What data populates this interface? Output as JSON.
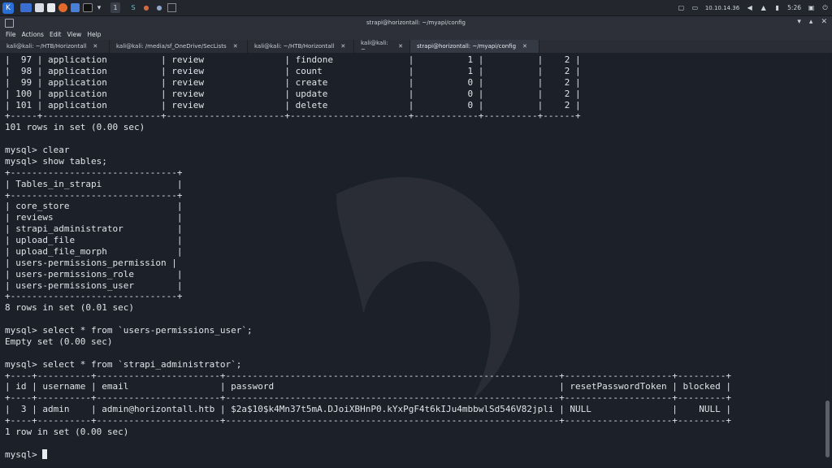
{
  "panel": {
    "workspace_label": "1",
    "ip_address": "10.10.14.36",
    "clock": "5:26"
  },
  "window": {
    "title": "strapi@horizontall: ~/myapi/config"
  },
  "menu": [
    "File",
    "Actions",
    "Edit",
    "View",
    "Help"
  ],
  "tabs": [
    {
      "label": "kali@kali: ~/HTB/Horizontall"
    },
    {
      "label": "kali@kali: /media/sf_OneDrive/SecLists"
    },
    {
      "label": "kali@kali: ~/HTB/Horizontall"
    },
    {
      "label": "kali@kali: ~"
    },
    {
      "label": "strapi@horizontall: ~/myapi/config"
    }
  ],
  "terminal": {
    "lines": [
      "|  97 | application          | review               | findone              |          1 |          |    2 |",
      "|  98 | application          | review               | count                |          1 |          |    2 |",
      "|  99 | application          | review               | create               |          0 |          |    2 |",
      "| 100 | application          | review               | update               |          0 |          |    2 |",
      "| 101 | application          | review               | delete               |          0 |          |    2 |",
      "+-----+----------------------+----------------------+----------------------+------------+----------+------+",
      "101 rows in set (0.00 sec)",
      "",
      "mysql> clear",
      "mysql> show tables;",
      "+-------------------------------+",
      "| Tables_in_strapi              |",
      "+-------------------------------+",
      "| core_store                    |",
      "| reviews                       |",
      "| strapi_administrator          |",
      "| upload_file                   |",
      "| upload_file_morph             |",
      "| users-permissions_permission |",
      "| users-permissions_role        |",
      "| users-permissions_user        |",
      "+-------------------------------+",
      "8 rows in set (0.01 sec)",
      "",
      "mysql> select * from `users-permissions_user`;",
      "Empty set (0.00 sec)",
      "",
      "mysql> select * from `strapi_administrator`;",
      "+----+----------+-----------------------+--------------------------------------------------------------+--------------------+---------+",
      "| id | username | email                 | password                                                     | resetPasswordToken | blocked |",
      "+----+----------+-----------------------+--------------------------------------------------------------+--------------------+---------+",
      "|  3 | admin    | admin@horizontall.htb | $2a$10$k4Mn37t5mA.DJoiXBHnP0.kYxPgF4t6kIJu4mbbwlSd546V82jpli | NULL               |    NULL |",
      "+----+----------+-----------------------+--------------------------------------------------------------+--------------------+---------+",
      "1 row in set (0.00 sec)",
      "",
      "mysql> "
    ]
  }
}
